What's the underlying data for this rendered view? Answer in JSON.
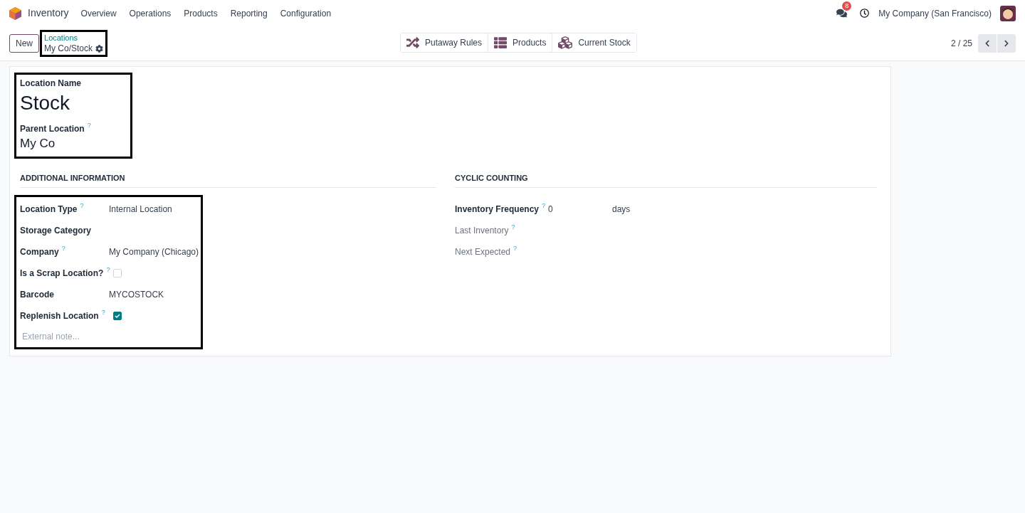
{
  "navbar": {
    "app": "Inventory",
    "menu": [
      "Overview",
      "Operations",
      "Products",
      "Reporting",
      "Configuration"
    ],
    "messages_badge": "8",
    "company": "My Company (San Francisco)"
  },
  "control_panel": {
    "new_button": "New",
    "breadcrumb": "Locations",
    "record": "My Co/Stock",
    "smart_buttons": [
      {
        "kind": "shuffle",
        "label": "Putaway Rules"
      },
      {
        "kind": "list",
        "label": "Products"
      },
      {
        "kind": "cubes",
        "label": "Current Stock"
      }
    ],
    "pager": "2 / 25"
  },
  "form": {
    "name_label": "Location Name",
    "name": "Stock",
    "parent_label": "Parent Location",
    "parent_help": "?",
    "parent": "My Co",
    "left_section": {
      "title": "ADDITIONAL INFORMATION",
      "fields": [
        {
          "kind": "text",
          "label": "Location Type",
          "help": "?",
          "value": "Internal Location"
        },
        {
          "kind": "text",
          "label": "Storage Category"
        },
        {
          "kind": "text",
          "label": "Company",
          "help": "?",
          "value": "My Company (Chicago)"
        },
        {
          "kind": "checkbox",
          "label": "Is a Scrap Location?",
          "help": "?",
          "checked": false
        },
        {
          "kind": "text",
          "label": "Barcode",
          "value": "MYCOSTOCK"
        },
        {
          "kind": "checkbox",
          "label": "Replenish Location",
          "help": "?",
          "checked": true
        }
      ]
    },
    "note_placeholder": "External note...",
    "right_section": {
      "title": "CYCLIC COUNTING",
      "fields": [
        {
          "kind": "number",
          "label": "Inventory Frequency",
          "help": "?",
          "value": "0",
          "unit": "days",
          "muted": false
        },
        {
          "kind": "text",
          "label": "Last Inventory",
          "help": "?",
          "muted": true
        },
        {
          "kind": "text",
          "label": "Next Expected",
          "help": "?",
          "muted": true
        }
      ]
    }
  }
}
